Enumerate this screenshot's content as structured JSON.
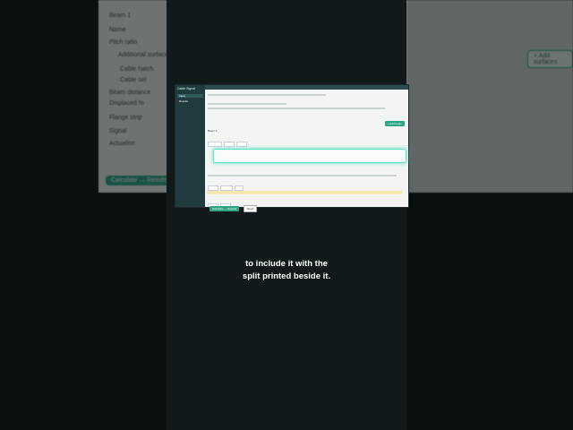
{
  "caption": {
    "line1": "to include it with the",
    "line2": "split printed beside it."
  },
  "background_zoom": {
    "beam_label": "Beam 1",
    "rows": [
      "Name",
      "Pitch ratio",
      "Additional surfaces",
      "Cable hatch",
      "Cable sel",
      "Beam distance",
      "Displaced %",
      "Flange strip",
      "Signal",
      "Actuation"
    ],
    "add_button": "+ Add surfaces",
    "calculate_button": "Calculate → Results"
  },
  "app": {
    "sidebar_title": "Cable Signal",
    "nav_items": [
      "Input",
      "Results"
    ],
    "section": "Beam 1",
    "add_button": "+ Add beam",
    "calculate_button": "Calculate → Results",
    "reset_button": "Reset"
  },
  "colors": {
    "accent": "#2fa584",
    "highlight": "#5fe0c3",
    "sidebar": "#1f3b3d"
  }
}
